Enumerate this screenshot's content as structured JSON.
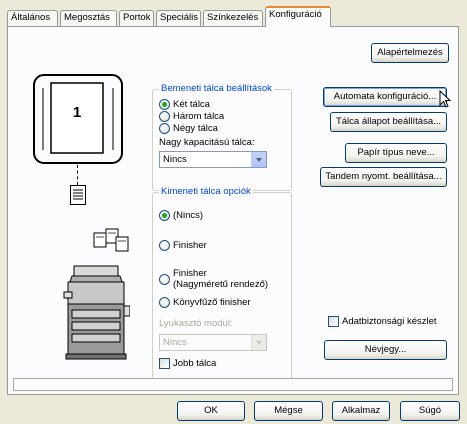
{
  "tabs": [
    "Általános",
    "Megosztás",
    "Portok",
    "Speciális",
    "Színkezelés",
    "Konfiguráció"
  ],
  "preview": {
    "tray_number": "1"
  },
  "input_group": {
    "legend": "Bemeneti tálca beállítások",
    "options": [
      "Két tálca",
      "Három tálca",
      "Négy tálca"
    ],
    "selected": "Két tálca",
    "large_capacity_label": "Nagy kapacitású tálca:",
    "large_capacity_value": "Nincs"
  },
  "output_group": {
    "legend": "Kimeneti tálca opciók",
    "opt_none": "(Nincs)",
    "opt_finisher": "Finisher",
    "opt_finisher_large_1": "Finisher",
    "opt_finisher_large_2": "(Nagyméretű rendező)",
    "opt_booklet": "Könyvfűző finisher",
    "selected": "(Nincs)",
    "punch_label": "Lyukasztó modul:",
    "punch_value": "Nincs",
    "right_tray_label": "Jobb tálca"
  },
  "buttons": {
    "defaults": "Alapértelmezés",
    "auto_config": "Automata konfiguráció...",
    "tray_status": "Tálca állapot beállítása...",
    "paper_type": "Papír típus neve...",
    "tandem": "Tandem nyomt. beállítása...",
    "name": "Névjegy...",
    "ok": "OK",
    "cancel": "Mégse",
    "apply": "Alkalmaz",
    "help": "Súgó"
  },
  "security_kit_label": "Adatbiztonsági készlet",
  "colors": {
    "active_tab_accent": "#e68b2c",
    "legend_text": "#0046d5",
    "radio_dot": "#21a121"
  }
}
